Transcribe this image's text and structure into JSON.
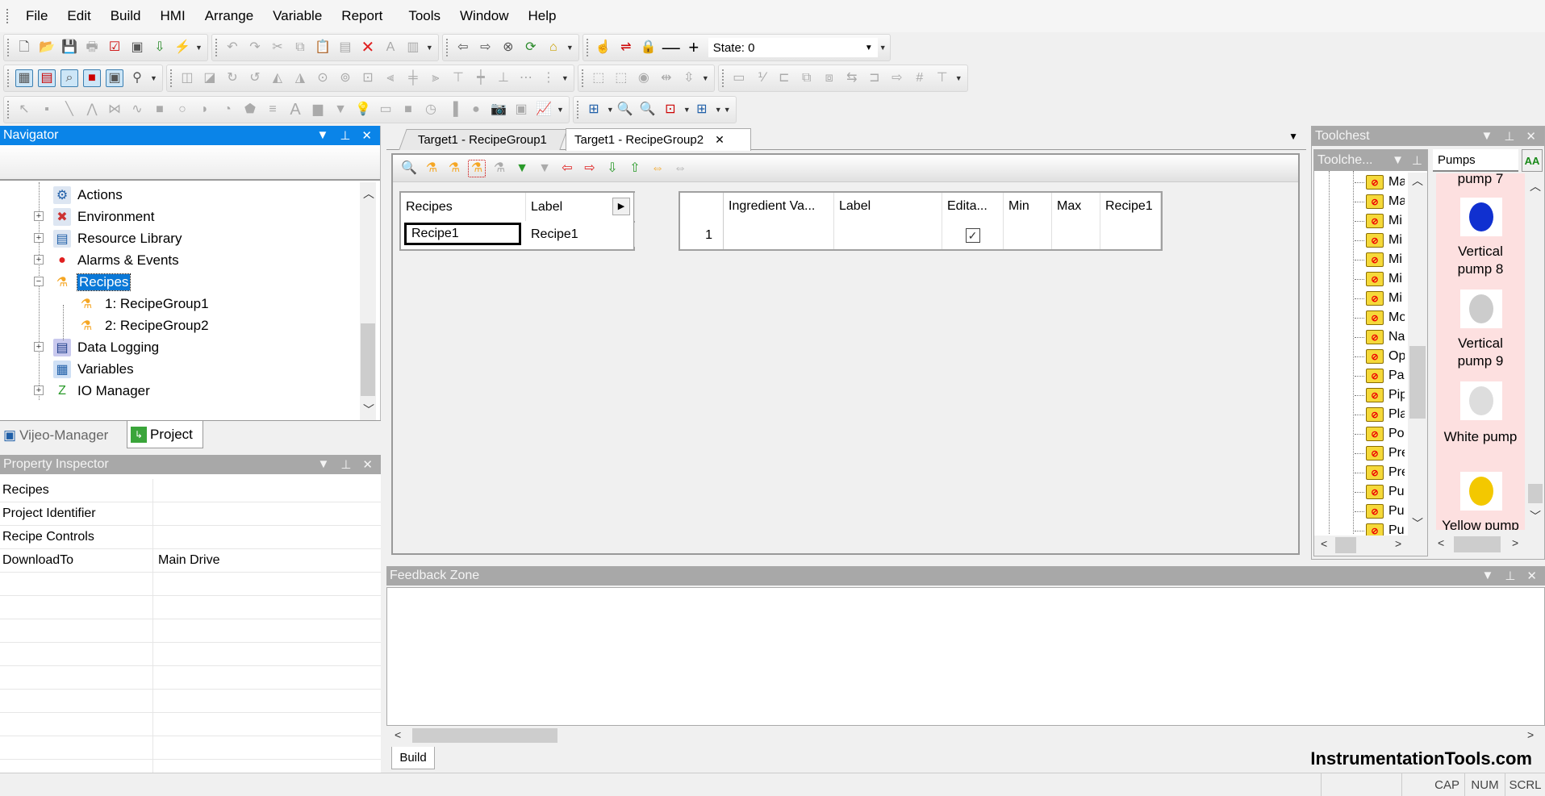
{
  "menu": [
    "File",
    "Edit",
    "Build",
    "HMI",
    "Arrange",
    "Variable",
    "Report",
    "Tools",
    "Window",
    "Help"
  ],
  "toolbar": {
    "state_label": "State: 0"
  },
  "navigator": {
    "title": "Navigator",
    "tree": [
      {
        "label": "Actions",
        "icon": "actions-icon",
        "expander": "none"
      },
      {
        "label": "Environment",
        "icon": "environment-icon",
        "expander": "plus"
      },
      {
        "label": "Resource Library",
        "icon": "resource-library-icon",
        "expander": "plus"
      },
      {
        "label": "Alarms & Events",
        "icon": "alarms-icon",
        "expander": "plus"
      },
      {
        "label": "Recipes",
        "icon": "flask-icon",
        "expander": "minus",
        "selected": true
      },
      {
        "label": "1: RecipeGroup1",
        "icon": "flask-icon",
        "child": true
      },
      {
        "label": "2: RecipeGroup2",
        "icon": "flask-icon",
        "child": true
      },
      {
        "label": "Data Logging",
        "icon": "data-logging-icon",
        "expander": "plus"
      },
      {
        "label": "Variables",
        "icon": "variables-icon",
        "expander": "none"
      },
      {
        "label": "IO Manager",
        "icon": "io-manager-icon",
        "expander": "plus"
      }
    ],
    "tabs": [
      "Vijeo-Manager",
      "Project"
    ],
    "active_tab": "Project"
  },
  "property_inspector": {
    "title": "Property Inspector",
    "rows": [
      {
        "key": "Recipes",
        "value": ""
      },
      {
        "key": "Project Identifier",
        "value": ""
      },
      {
        "key": "Recipe Controls",
        "value": ""
      },
      {
        "key": "DownloadTo",
        "value": "Main Drive"
      }
    ]
  },
  "editor": {
    "tabs": [
      "Target1 - RecipeGroup1",
      "Target1 - RecipeGroup2"
    ],
    "active_tab": "Target1 - RecipeGroup2",
    "close_glyph": "✕",
    "recipes_grid": {
      "headers": [
        "Recipes",
        "Label"
      ],
      "rows": [
        [
          "Recipe1",
          "Recipe1"
        ]
      ]
    },
    "ingredients_grid": {
      "headers": [
        "",
        "Ingredient Va...",
        "Label",
        "Edita...",
        "Min",
        "Max",
        "Recipe1"
      ],
      "rows": [
        {
          "index": "1",
          "ingredient": "",
          "label": "",
          "editable": true,
          "min": "",
          "max": "",
          "recipe1": ""
        }
      ]
    }
  },
  "feedback": {
    "title": "Feedback Zone",
    "tabs": [
      "Build"
    ]
  },
  "toolchest": {
    "title": "Toolchest",
    "sub_title": "Toolche...",
    "folders": [
      "Ma",
      "Ma",
      "Mi",
      "Mi",
      "Mi",
      "Mi",
      "Mi",
      "Mo",
      "Na",
      "Op",
      "Pa",
      "Pip",
      "Pla",
      "Po",
      "Pre",
      "Pre",
      "Pu",
      "Pu",
      "Pu"
    ],
    "category": "Pumps",
    "items": [
      "pump 7",
      "Vertical pump 8",
      "Vertical pump 9",
      "White pump",
      "Yellow pump"
    ],
    "background": "#fde0e0"
  },
  "watermark": "InstrumentationTools.com",
  "status": [
    "CAP",
    "NUM",
    "SCRL"
  ],
  "colors": {
    "accent": "#0a84e8",
    "selection": "#0a78d7",
    "flask": "#f5a623"
  }
}
